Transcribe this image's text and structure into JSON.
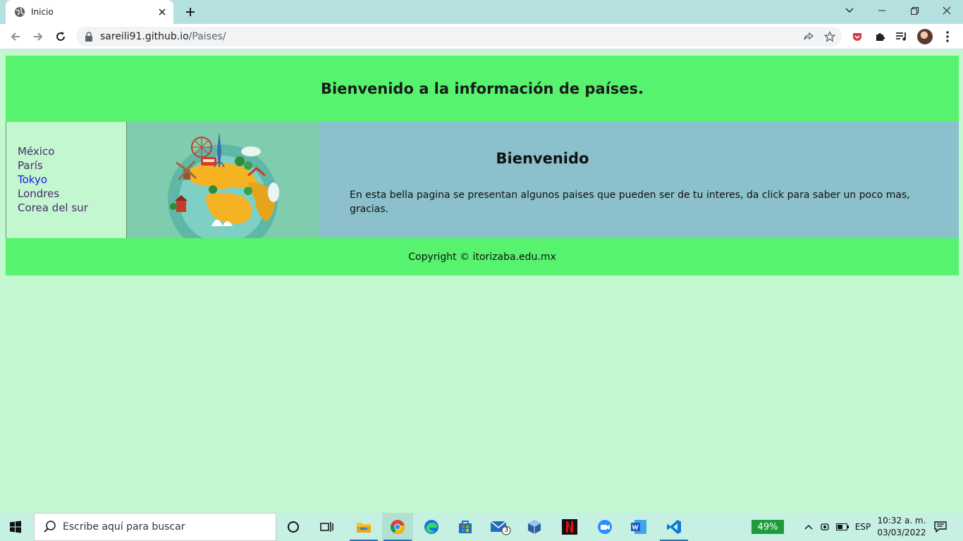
{
  "browser": {
    "tab_title": "Inicio",
    "url_host": "sareili91.github.io",
    "url_path": "/Paises/"
  },
  "site": {
    "header_title": "Bienvenido a la información de países.",
    "nav": [
      {
        "label": "México"
      },
      {
        "label": "París"
      },
      {
        "label": "Tokyo"
      },
      {
        "label": "Londres"
      },
      {
        "label": "Corea del sur"
      }
    ],
    "welcome_heading": "Bienvenido",
    "welcome_text": "En esta bella pagina se presentan algunos paises que pueden ser de tu interes, da click para saber un poco mas, gracias.",
    "footer": "Copyright © itorizaba.edu.mx"
  },
  "taskbar": {
    "search_placeholder": "Escribe aquí para buscar",
    "mail_badge": "3",
    "battery": "49%",
    "language": "ESP",
    "time": "10:32 a. m.",
    "date": "03/03/2022"
  },
  "colors": {
    "page_bg": "#c2f7d0",
    "header_green": "#57f36e",
    "hero_bg": "#80ccae",
    "welcome_bg": "#8bc0cc",
    "link_active": "#1a1ae0",
    "link": "#4a2a6a"
  }
}
